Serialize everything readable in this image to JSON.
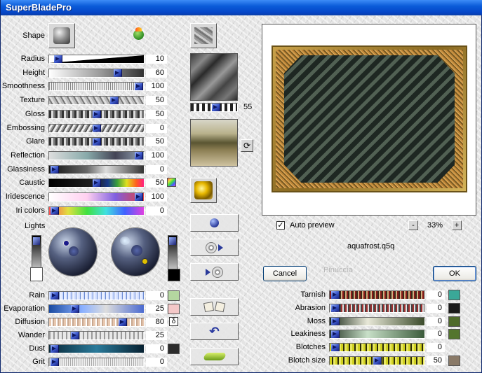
{
  "window": {
    "title": "SuperBladePro"
  },
  "shape": {
    "label": "Shape"
  },
  "left_sliders": [
    {
      "label": "Radius",
      "value": "10",
      "fraction": 0.06,
      "style": "wedge"
    },
    {
      "label": "Height",
      "value": "60",
      "fraction": 0.74,
      "style": "gray-grad"
    },
    {
      "label": "Smoothness",
      "value": "100",
      "fraction": 0.98,
      "style": "dots"
    },
    {
      "label": "Texture",
      "value": "50",
      "fraction": 0.7,
      "style": "stone"
    },
    {
      "label": "Gloss",
      "value": "50",
      "fraction": 0.5,
      "style": "chrome"
    },
    {
      "label": "Embossing",
      "value": "0",
      "fraction": 0.5,
      "style": "emboss"
    },
    {
      "label": "Glare",
      "value": "50",
      "fraction": 0.5,
      "style": "chrome"
    },
    {
      "label": "Reflection",
      "value": "100",
      "fraction": 0.98,
      "style": "sky"
    },
    {
      "label": "Glassiness",
      "value": "0",
      "fraction": 0.02,
      "style": "glass"
    },
    {
      "label": "Caustic",
      "value": "50",
      "fraction": 0.5,
      "style": "caustic"
    },
    {
      "label": "Iridescence",
      "value": "100",
      "fraction": 0.98,
      "style": "iri"
    },
    {
      "label": "Iri colors",
      "value": "0",
      "fraction": 0.02,
      "style": "rainbow"
    }
  ],
  "texture_slider": {
    "value": "55",
    "fraction": 0.55
  },
  "lights": {
    "label": "Lights"
  },
  "bottom_left_sliders": [
    {
      "label": "Rain",
      "value": "0",
      "fraction": 0.02,
      "style": "rain",
      "swatch": "#b4d6a0"
    },
    {
      "label": "Evaporation",
      "value": "25",
      "fraction": 0.25,
      "style": "evap",
      "swatch": "#f4c8c8"
    },
    {
      "label": "Diffusion",
      "value": "80",
      "fraction": 0.8,
      "style": "diff",
      "swatch": ""
    },
    {
      "label": "Wander",
      "value": "25",
      "fraction": 0.25,
      "style": "wander",
      "swatch": ""
    },
    {
      "label": "Dust",
      "value": "0",
      "fraction": 0.02,
      "style": "dust",
      "swatch": "#2c2c2c"
    },
    {
      "label": "Grit",
      "value": "0",
      "fraction": 0.02,
      "style": "grit",
      "swatch": ""
    }
  ],
  "bottom_right_sliders": [
    {
      "label": "Tarnish",
      "value": "0",
      "fraction": 0.02,
      "style": "tarnish",
      "swatch": "#3aa898"
    },
    {
      "label": "Abrasion",
      "value": "0",
      "fraction": 0.02,
      "style": "abrasion",
      "swatch": "#1a1a1a"
    },
    {
      "label": "Moss",
      "value": "0",
      "fraction": 0.02,
      "style": "moss",
      "swatch": "#4e6a2a"
    },
    {
      "label": "Leakiness",
      "value": "0",
      "fraction": 0.02,
      "style": "leak",
      "swatch": "#54752e"
    },
    {
      "label": "Blotches",
      "value": "0",
      "fraction": 0.02,
      "style": "blotch",
      "swatch": ""
    },
    {
      "label": "Blotch size",
      "value": "50",
      "fraction": 0.5,
      "style": "blotch",
      "swatch": "#8a7a68"
    }
  ],
  "preview": {
    "auto_label": "Auto preview",
    "auto_checked": true,
    "zoom": "33%",
    "zoom_minus": "-",
    "zoom_plus": "+",
    "filename": "aquafrost.q5q",
    "watermark": "Pinuccia"
  },
  "buttons": {
    "cancel": "Cancel",
    "ok": "OK"
  },
  "colors": {
    "titlebar": "#0a5bd8",
    "frame_gold": "#b8922e",
    "thumb": "#3a56c8"
  }
}
